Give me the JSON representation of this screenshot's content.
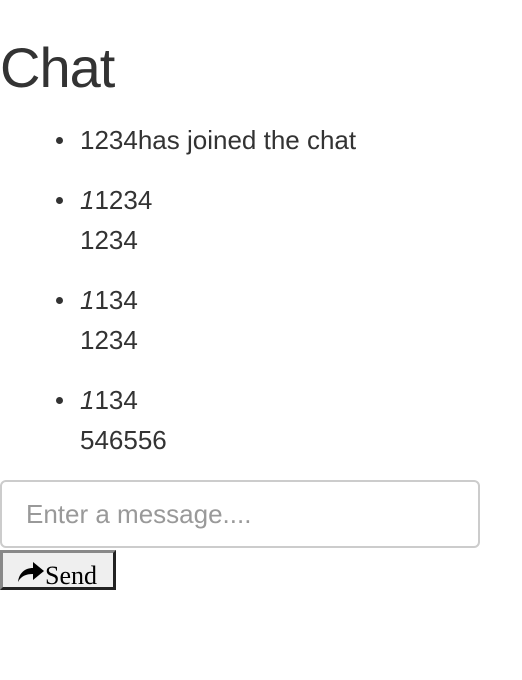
{
  "header": {
    "title": "Chat"
  },
  "messages": [
    {
      "mark": "",
      "lines": [
        "1234has joined the chat"
      ]
    },
    {
      "mark": "1",
      "lines": [
        "1234",
        "1234"
      ]
    },
    {
      "mark": "1",
      "lines": [
        "134",
        "1234"
      ]
    },
    {
      "mark": "1",
      "lines": [
        "134",
        "546556"
      ]
    }
  ],
  "composer": {
    "placeholder": "Enter a message....",
    "value": "",
    "send_label": "Send",
    "send_icon": "share-arrow-icon"
  }
}
